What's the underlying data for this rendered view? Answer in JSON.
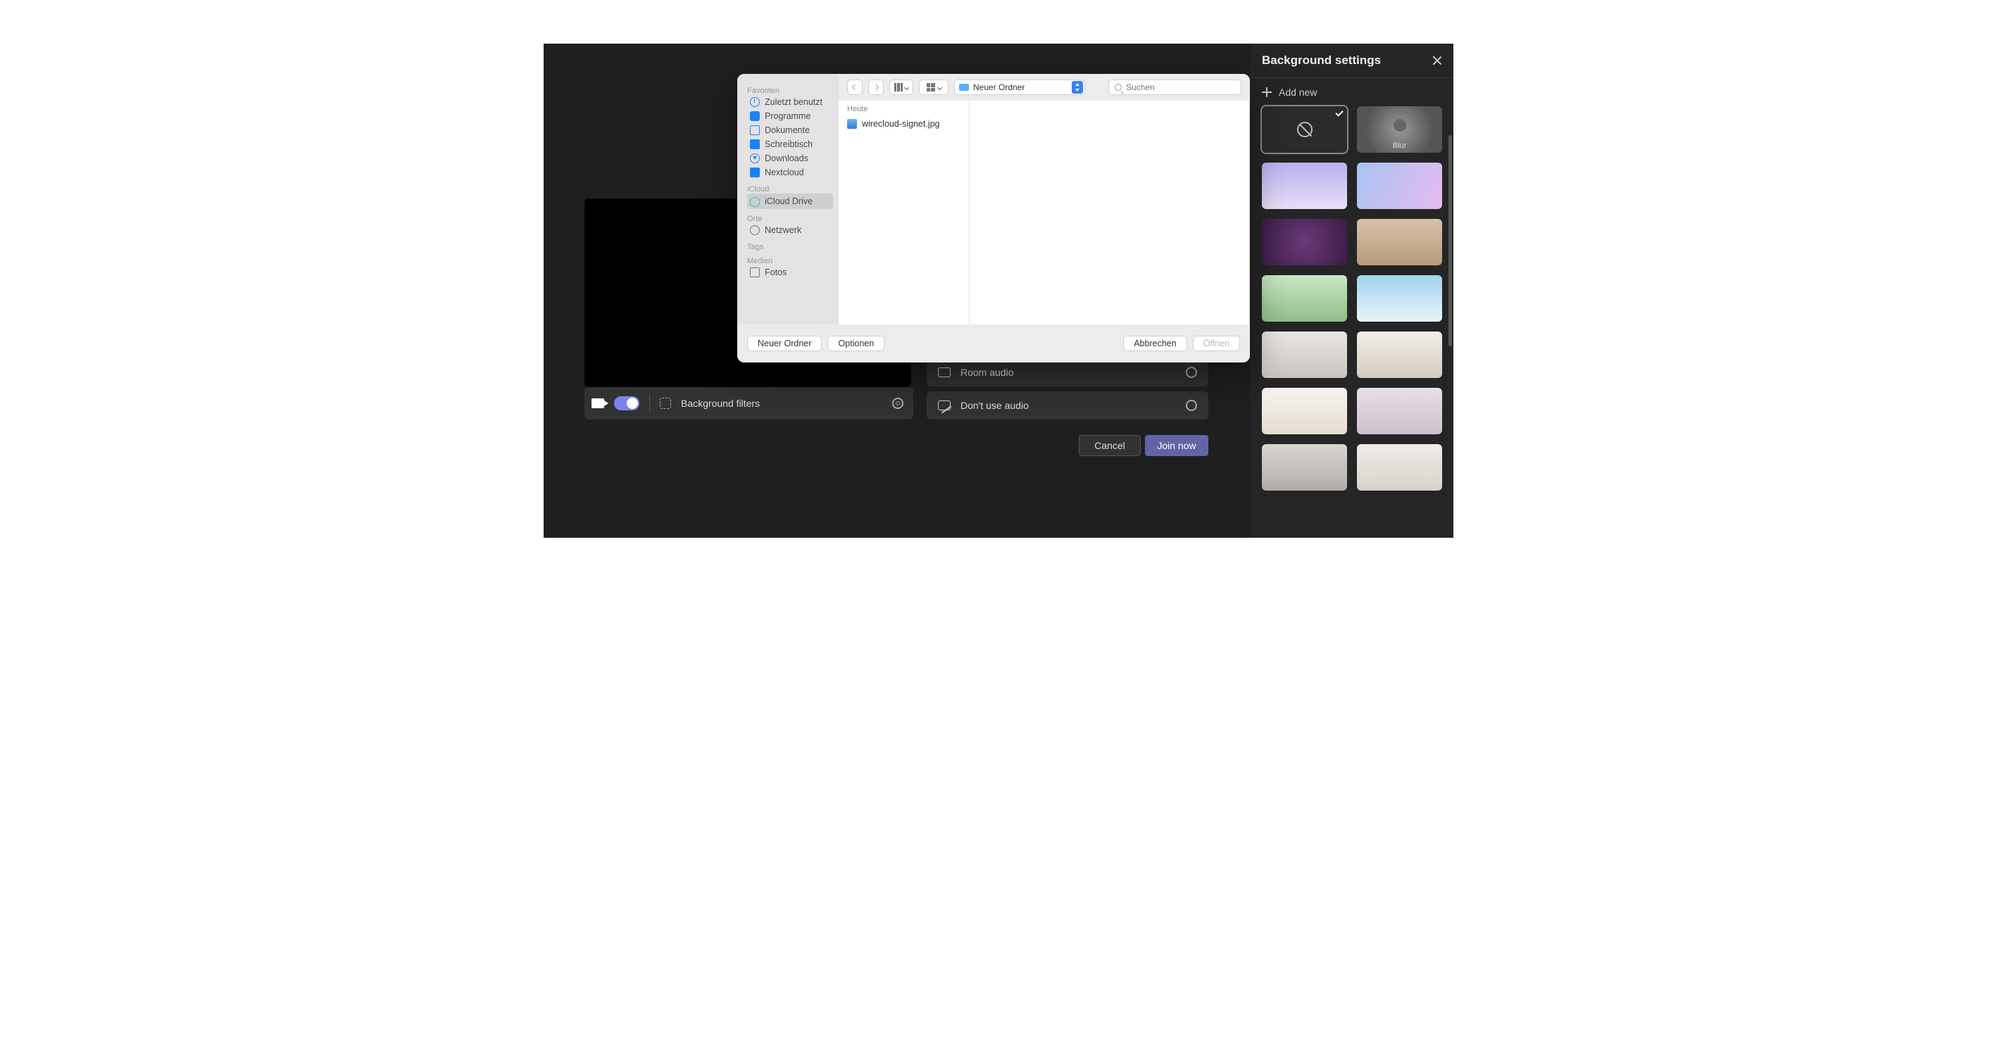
{
  "teams": {
    "background_filters_label": "Background filters",
    "room_audio_label": "Room audio",
    "no_audio_label": "Don't use audio",
    "cancel_label": "Cancel",
    "join_label": "Join now"
  },
  "side": {
    "title": "Background settings",
    "add_new": "Add new",
    "blur_label": "Blur",
    "tiles": [
      {
        "id": "none",
        "cls": "t-none",
        "selected": true
      },
      {
        "id": "blur",
        "cls": "t-blur",
        "label": "Blur"
      },
      {
        "id": "bg1",
        "cls": "t-a"
      },
      {
        "id": "bg2",
        "cls": "t-b"
      },
      {
        "id": "bg3",
        "cls": "t-c"
      },
      {
        "id": "bg4",
        "cls": "t-d"
      },
      {
        "id": "bg5",
        "cls": "t-e"
      },
      {
        "id": "bg6",
        "cls": "t-f"
      },
      {
        "id": "bg7",
        "cls": "t-g"
      },
      {
        "id": "bg8",
        "cls": "t-h"
      },
      {
        "id": "bg9",
        "cls": "t-i"
      },
      {
        "id": "bg10",
        "cls": "t-j"
      },
      {
        "id": "bg11",
        "cls": "t-k"
      },
      {
        "id": "bg12",
        "cls": "t-l"
      }
    ]
  },
  "finder": {
    "sidebar": {
      "sections": [
        {
          "label": "Favoriten",
          "items": [
            {
              "label": "Zuletzt benutzt",
              "icon": "ic-clock"
            },
            {
              "label": "Programme",
              "icon": "ic-app"
            },
            {
              "label": "Dokumente",
              "icon": "ic-doc"
            },
            {
              "label": "Schreibtisch",
              "icon": "ic-desk"
            },
            {
              "label": "Downloads",
              "icon": "ic-down"
            },
            {
              "label": "Nextcloud",
              "icon": "ic-fold"
            }
          ]
        },
        {
          "label": "iCloud",
          "items": [
            {
              "label": "iCloud Drive",
              "icon": "ic-cloud",
              "selected": true
            }
          ]
        },
        {
          "label": "Orte",
          "items": [
            {
              "label": "Netzwerk",
              "icon": "ic-net"
            }
          ]
        },
        {
          "label": "Tags",
          "items": []
        },
        {
          "label": "Medien",
          "items": [
            {
              "label": "Fotos",
              "icon": "ic-photo"
            }
          ]
        }
      ]
    },
    "location": "Neuer Ordner",
    "search_placeholder": "Suchen",
    "col_header": "Heute",
    "file_name": "wirecloud-signet.jpg",
    "btn_new_folder": "Neuer Ordner",
    "btn_options": "Optionen",
    "btn_cancel": "Abbrechen",
    "btn_open": "Öffnen"
  }
}
